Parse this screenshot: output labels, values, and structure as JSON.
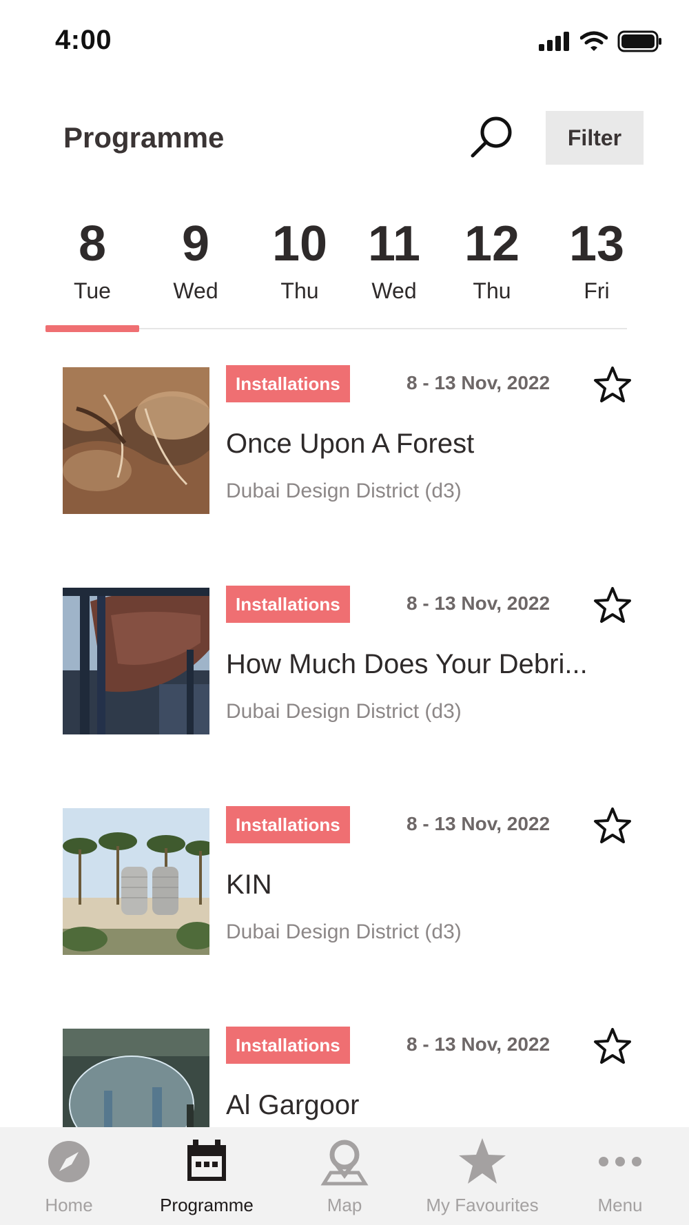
{
  "status_bar": {
    "time": "4:00"
  },
  "header": {
    "title": "Programme",
    "filter_label": "Filter"
  },
  "date_tabs": [
    {
      "num": "8",
      "day": "Tue",
      "selected": true
    },
    {
      "num": "9",
      "day": "Wed"
    },
    {
      "num": "10",
      "day": "Thu"
    },
    {
      "num": "11",
      "day": "Wed"
    },
    {
      "num": "12",
      "day": "Thu"
    },
    {
      "num": "13",
      "day": "Fri"
    }
  ],
  "events": [
    {
      "tag": "Installations",
      "date": "8 - 13 Nov, 2022",
      "title": "Once Upon A Forest",
      "venue": "Dubai Design District (d3)"
    },
    {
      "tag": "Installations",
      "date": "8 - 13 Nov, 2022",
      "title": "How Much Does Your Debri...",
      "venue": "Dubai Design District (d3)"
    },
    {
      "tag": "Installations",
      "date": "8 - 13 Nov, 2022",
      "title": "KIN",
      "venue": "Dubai Design District (d3)"
    },
    {
      "tag": "Installations",
      "date": "8 - 13 Nov, 2022",
      "title": "Al Gargoor",
      "venue": ""
    }
  ],
  "bottom_nav": [
    {
      "label": "Home",
      "icon": "compass-icon"
    },
    {
      "label": "Programme",
      "icon": "calendar-icon",
      "active": true
    },
    {
      "label": "Map",
      "icon": "map-pin-icon"
    },
    {
      "label": "My Favourites",
      "icon": "star-icon"
    },
    {
      "label": "Menu",
      "icon": "more-dots-icon"
    }
  ],
  "colors": {
    "accent": "#ef6f72",
    "text": "#2e2a2a",
    "muted": "#8c8787",
    "nav_bg": "#f2f2f2"
  }
}
